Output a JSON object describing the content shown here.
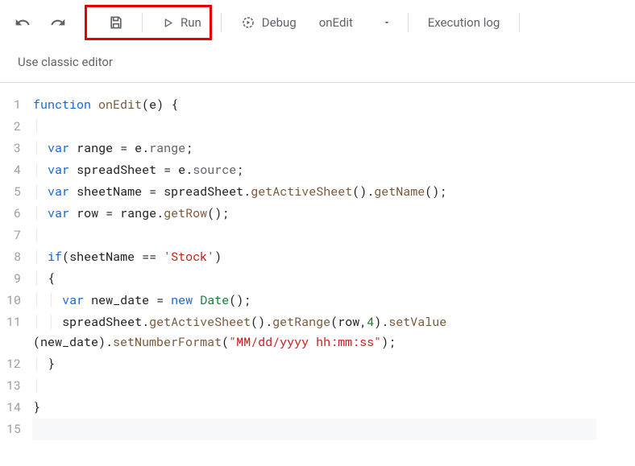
{
  "toolbar": {
    "run_label": "Run",
    "debug_label": "Debug",
    "function_selected": "onEdit",
    "execution_log_label": "Execution log"
  },
  "classic_editor_label": "Use classic editor",
  "highlight_target": "save-and-run-group",
  "code": {
    "lines": [
      {
        "n": 1
      },
      {
        "n": 2
      },
      {
        "n": 3
      },
      {
        "n": 4
      },
      {
        "n": 5
      },
      {
        "n": 6
      },
      {
        "n": 7
      },
      {
        "n": 8
      },
      {
        "n": 9
      },
      {
        "n": 10
      },
      {
        "n": 11
      },
      {
        "n": 12
      },
      {
        "n": 13
      },
      {
        "n": 14
      },
      {
        "n": 15
      }
    ],
    "tokens": {
      "kw_function": "function",
      "fn_name": "onEdit",
      "param_e": "e",
      "kw_var": "var",
      "id_range": "range",
      "prop_range": "range",
      "id_spreadSheet": "spreadSheet",
      "prop_source": "source",
      "id_sheetName": "sheetName",
      "m_getActiveSheet": "getActiveSheet",
      "m_getName": "getName",
      "id_row": "row",
      "m_getRow": "getRow",
      "kw_if": "if",
      "str_stock": "'Stock'",
      "id_new_date": "new_date",
      "kw_new": "new",
      "type_Date": "Date",
      "m_getRange": "getRange",
      "num_4": "4",
      "m_setValue": "setValue",
      "m_setNumberFormat": "setNumberFormat",
      "str_fmt": "\"MM/dd/yyyy hh:mm:ss\""
    }
  }
}
